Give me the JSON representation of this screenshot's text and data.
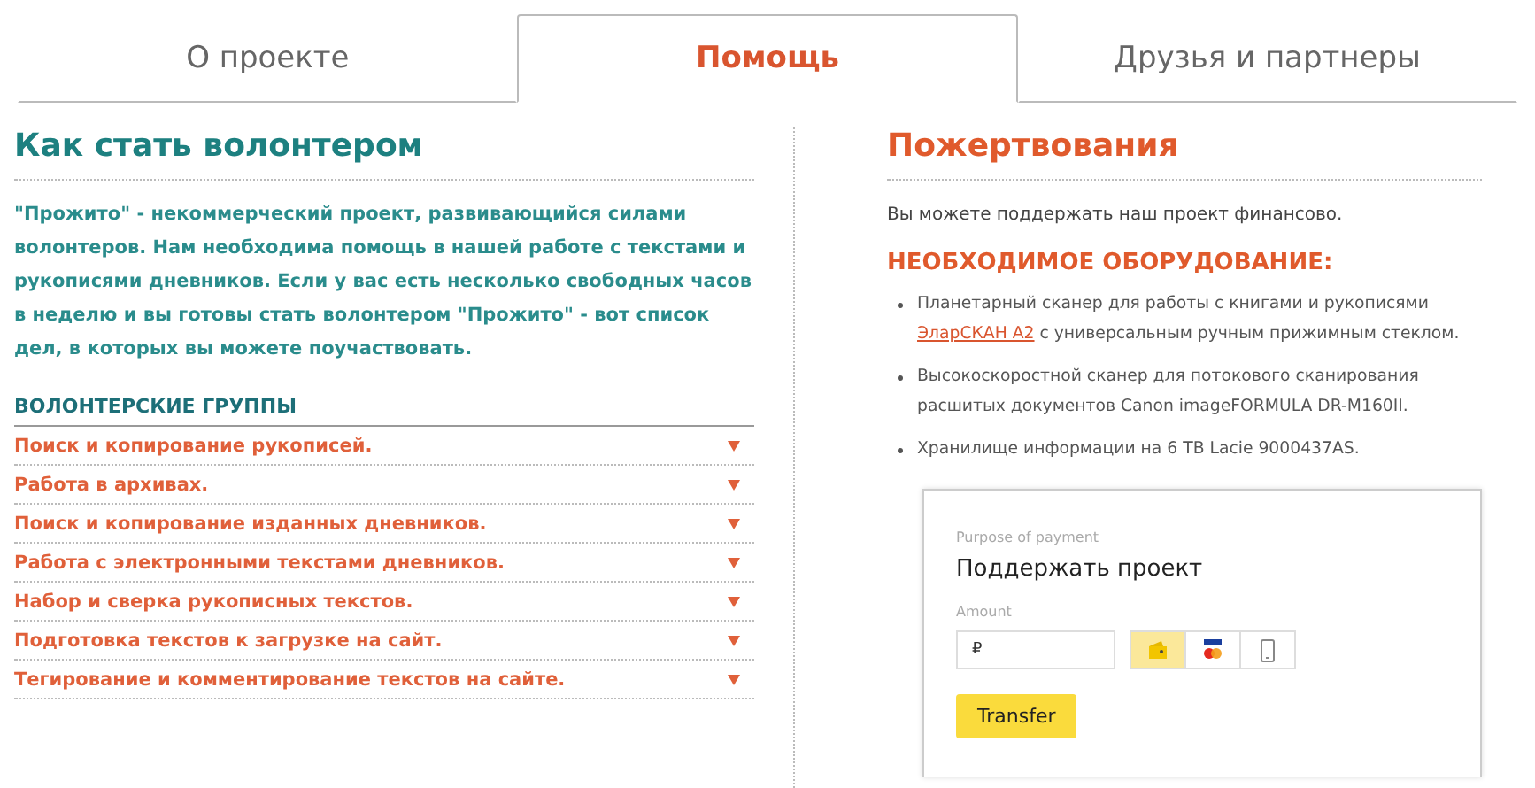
{
  "tabs": [
    {
      "label": "О проекте",
      "selected": false
    },
    {
      "label": "Помощь",
      "selected": true
    },
    {
      "label": "Друзья и партнеры",
      "selected": false
    }
  ],
  "volunteer": {
    "title": "Как стать волонтером",
    "intro": "\"Прожито\" - некоммерческий проект, развивающийся силами волонтеров. Нам необходима помощь в нашей работе с текстами и рукописями дневников. Если у вас есть несколько свободных часов в неделю и вы готовы стать волонтером \"Прожито\" - вот список дел, в которых вы можете поучаствовать.",
    "groups_title": "ВОЛОНТЕРСКИЕ ГРУППЫ",
    "groups": [
      {
        "label": "Поиск и копирование рукописей.",
        "expanded": false
      },
      {
        "label": "Работа в архивах.",
        "expanded": false
      },
      {
        "label": "Поиск и копирование изданных дневников.",
        "expanded": false
      },
      {
        "label": "Работа с электронными текстами дневников.",
        "expanded": false
      },
      {
        "label": "Набор и сверка рукописных текстов.",
        "expanded": false
      },
      {
        "label": "Подготовка текстов к загрузке на сайт.",
        "expanded": false
      },
      {
        "label": "Тегирование и комментирование текстов на сайте.",
        "expanded": false
      }
    ]
  },
  "donations": {
    "title": "Пожертвования",
    "intro": "Вы можете поддержать наш проект финансово.",
    "equipment_title": "НЕОБХОДИМОЕ ОБОРУДОВАНИЕ:",
    "equipment": [
      {
        "text": "Планетарный сканер для работы с книгами и рукописями",
        "link": "ЭларСКАН А2",
        "text_after": "с универсальным ручным прижимным стеклом."
      },
      {
        "text": "Высокоскоростной сканер для потокового сканирования расшитых документов Canon imageFORMULA DR-M160II."
      },
      {
        "text": "Хранилище информации на 6 TB Lacie 9000437AS."
      }
    ],
    "payment": {
      "purpose_label": "Purpose of payment",
      "purpose": "Поддержать проект",
      "amount_label": "Amount",
      "amount_value": "₽",
      "methods": [
        {
          "kind": "wallet",
          "selected": true
        },
        {
          "kind": "card",
          "selected": false
        },
        {
          "kind": "phone",
          "selected": false
        }
      ],
      "button": "Transfer"
    }
  }
}
